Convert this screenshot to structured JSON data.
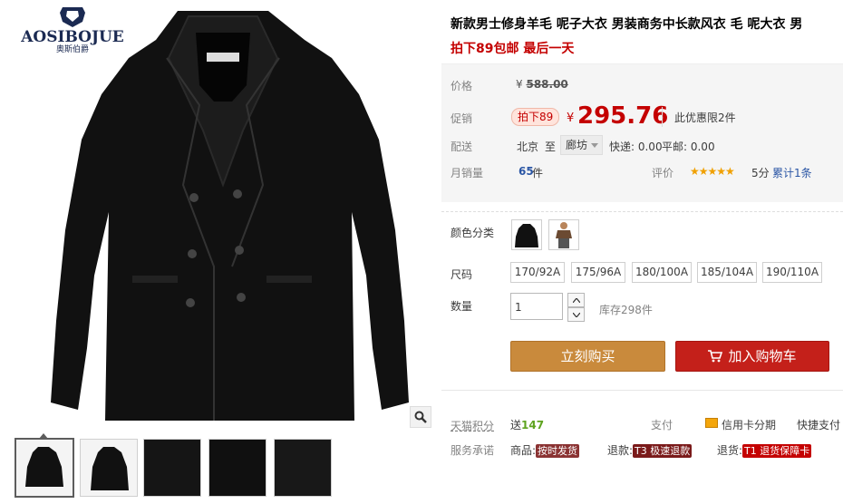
{
  "brand": {
    "name": "AOSIBOJUE",
    "subtitle": "奥斯伯爵"
  },
  "product": {
    "title": "新款男士修身羊毛 呢子大衣 男装商务中长款风衣 毛 呢大衣 男",
    "promo_line": "拍下89包邮  最后一天"
  },
  "price": {
    "original_label": "价格",
    "original_currency": "¥",
    "original_value": "588.00",
    "promo_label": "促销",
    "promo_tag": "拍下89",
    "currency": "¥",
    "current": "295.76",
    "limit_text": "此优惠限2件"
  },
  "shipping": {
    "label": "配送",
    "from": "北京",
    "to_word": "至",
    "destination": "廊坊",
    "express_fee": "快递: 0.00",
    "mail_fee": "平邮: 0.00"
  },
  "sales": {
    "label": "月销量",
    "count": "65",
    "unit": "件"
  },
  "rating": {
    "label": "评价",
    "stars": "★★★★★",
    "score": "5分",
    "reviews": "累计1条"
  },
  "options": {
    "color_label": "颜色分类",
    "colors": [
      "black-coat",
      "brown-outfit"
    ],
    "size_label": "尺码",
    "sizes": [
      "170/92A",
      "175/96A",
      "180/100A",
      "185/104A",
      "190/110A"
    ],
    "qty_label": "数量",
    "qty_value": "1",
    "stock": "库存298件"
  },
  "actions": {
    "buy_now": "立刻购买",
    "add_to_cart": "加入购物车"
  },
  "extras": {
    "points_label": "天猫积分",
    "points_prefix": "送",
    "points_value": "147",
    "pay_label": "支付",
    "credit_installment": "信用卡分期",
    "fast_pay": "快捷支付"
  },
  "services": {
    "label": "服务承诺",
    "goods_label": "商品:",
    "goods_tag": "按时发货",
    "refund_label": "退款:",
    "refund_tag": "T3 极速退款",
    "return_label": "退货:",
    "return_tag": "T1 退货保障卡"
  },
  "colors": {
    "price_red": "#c40000",
    "buy_orange": "#c98a3c",
    "cart_red": "#c4201a",
    "link_blue": "#2b56a5",
    "points_green": "#5ea31f"
  }
}
